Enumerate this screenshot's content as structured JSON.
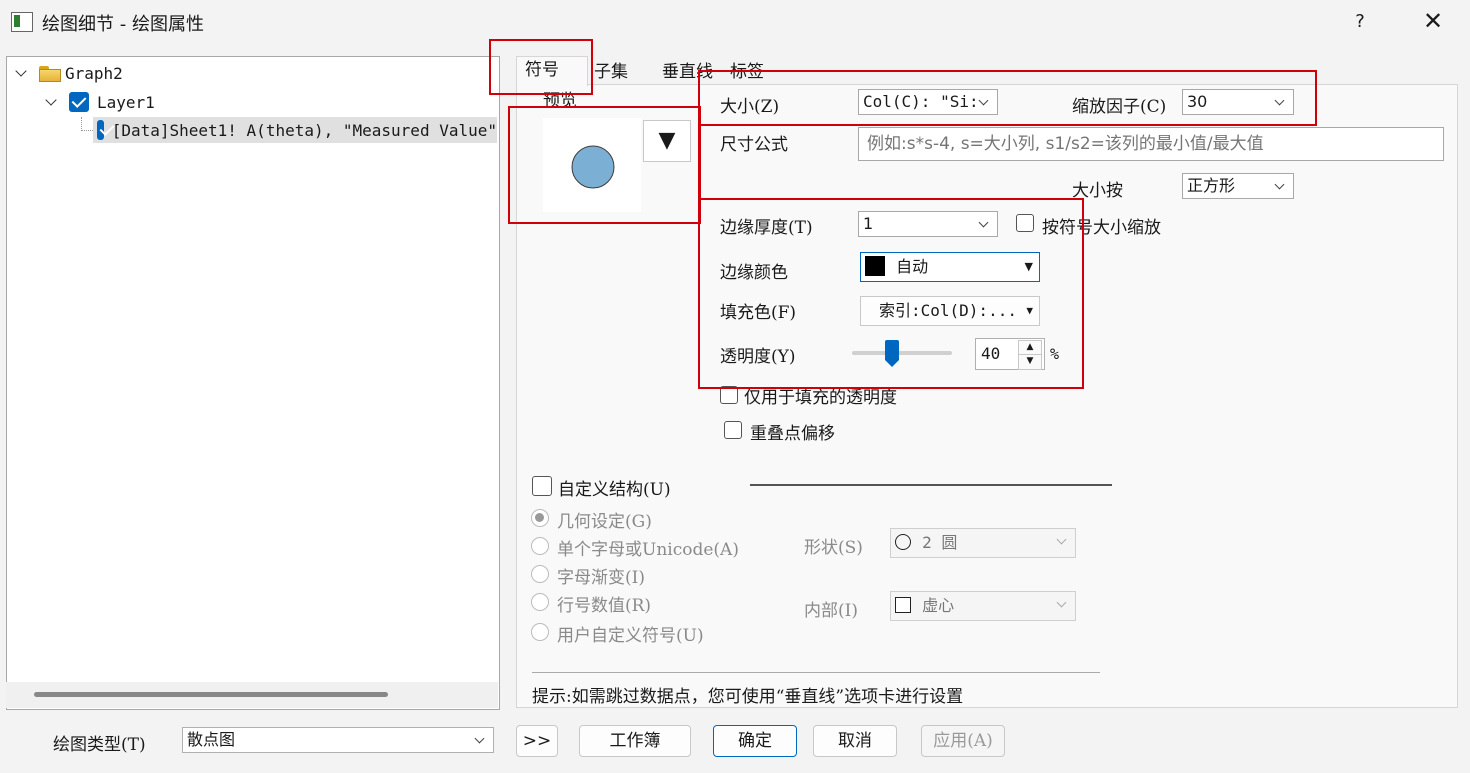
{
  "window": {
    "title": "绘图细节 - 绘图属性",
    "help_label": "?",
    "close_label": "✕"
  },
  "tree": {
    "items": [
      {
        "label": "Graph2"
      },
      {
        "label": "Layer1"
      },
      {
        "label": "[Data]Sheet1! A(theta), \"Measured Value\""
      }
    ]
  },
  "tabs": [
    {
      "label": "符号",
      "active": true
    },
    {
      "label": "子集"
    },
    {
      "label": "垂直线"
    },
    {
      "label": "标签"
    }
  ],
  "preview": {
    "label": "预览",
    "symbol_color": "#7bafd4",
    "dropdown_glyph": "▼"
  },
  "size": {
    "label": "大小(Z)",
    "value": "Col(C): \"Si:",
    "scale_label": "缩放因子(C)",
    "scale_value": "30",
    "formula_label": "尺寸公式",
    "formula_placeholder": "例如:s*s-4, s=大小列, s1/s2=该列的最小值/最大值",
    "size_by_label": "大小按",
    "size_by_value": "正方形"
  },
  "edge": {
    "thickness_label": "边缘厚度(T)",
    "thickness_value": "1",
    "scale_with_symbol_label": "按符号大小缩放",
    "color_label": "边缘颜色",
    "color_value": "自动",
    "color_swatch": "#000000",
    "fill_label": "填充色(F)",
    "fill_value": "索引:Col(D):...",
    "transparency_label": "透明度(Y)",
    "transparency_value": "40",
    "transparency_unit": "%",
    "transparency_percent": 40,
    "fill_only_label": "仅用于填充的透明度",
    "overlap_label": "重叠点偏移"
  },
  "custom": {
    "construct_label": "自定义结构(U)",
    "options": [
      {
        "label": "几何设定(G)",
        "selected": true
      },
      {
        "label": "单个字母或Unicode(A)"
      },
      {
        "label": "字母渐变(I)"
      },
      {
        "label": "行号数值(R)"
      },
      {
        "label": "用户自定义符号(U)"
      }
    ],
    "shape_label": "形状(S)",
    "shape_value": "2 圆",
    "interior_label": "内部(I)",
    "interior_value": "虚心"
  },
  "hint": "提示:如需跳过数据点，您可使用“垂直线”选项卡进行设置",
  "footer": {
    "plot_type_label": "绘图类型(T)",
    "plot_type_value": "散点图",
    "expand_label": ">>",
    "workbook_label": "工作簿",
    "ok_label": "确定",
    "cancel_label": "取消",
    "apply_label": "应用(A)"
  }
}
